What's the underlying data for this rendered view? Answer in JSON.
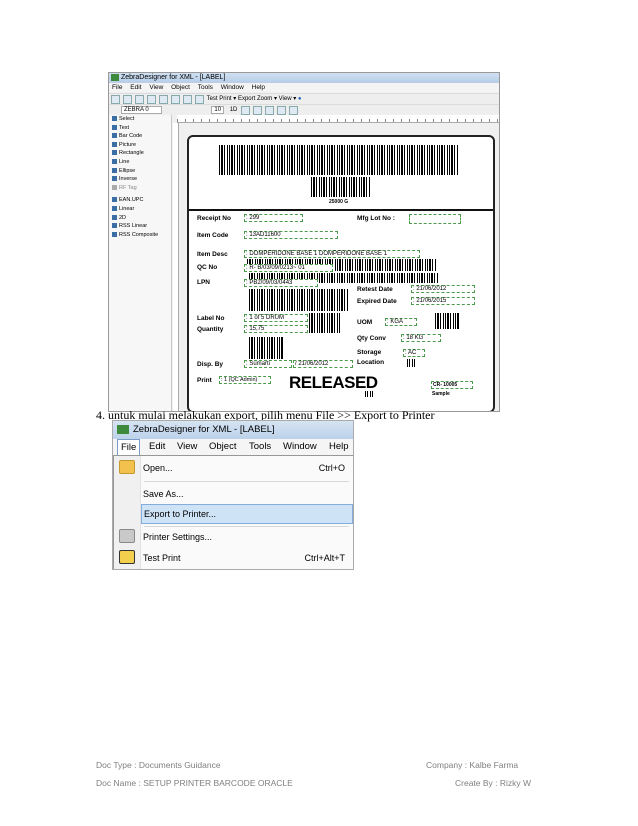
{
  "shot1": {
    "title": "ZebraDesigner for XML - [LABEL]",
    "menu": [
      "File",
      "Edit",
      "View",
      "Object",
      "Tools",
      "Window",
      "Help"
    ],
    "toolbar1": {
      "test_print": "Test Print",
      "export": "Export",
      "zoom": "Zoom",
      "view": "View"
    },
    "toolbar2": {
      "printer": "ZEBRA 0",
      "font_size": "10",
      "mode": "1D"
    },
    "palette": [
      "Select",
      "Text",
      "Bar Code",
      "Picture",
      "Rectangle",
      "Line",
      "Ellipse",
      "Inverse",
      "RF Tag",
      "EAN.UPC",
      "Linear",
      "2D",
      "RSS Linear",
      "RSS Composite"
    ],
    "label": {
      "barcode_caption": "25000 G",
      "receipt_no_label": "Receipt No",
      "receipt_no": ": 299",
      "mfg_lot_label": "Mfg Lot No :",
      "item_code_label": "Item Code",
      "item_code": ": 13AD11600",
      "item_desc_label": "Item Desc",
      "item_desc": ": DOMPERIDONE BASE 1  DOMPERIDONE BASE 1",
      "qc_no_label": "QC No",
      "qc_no": ": R-  B/03/09/0213~ 01",
      "lpn_label": "LPN",
      "lpn": ": PB2/09/03/0443",
      "retest_label": "Retest Date",
      "retest": ": 21/06/2012",
      "expired_label": "Expired Date",
      "expired": ": 21/06/2015",
      "label_no_label": "Label No",
      "label_no": ": 1 of 5 DRUM",
      "quantity_label": "Quantity",
      "quantity": ": 15,75",
      "uom_label": "UOM",
      "uom": ":  KGA",
      "qty_conv_label": "Qty Conv",
      "qty_conv": ": 18 KG",
      "storage_label": "Storage",
      "location_label": "Location",
      "storage": ": AC",
      "disp_by_label": "Disp. By",
      "disp_by": ": Sumarti",
      "disp_date": "/ 21/06/2012",
      "print_label": "Print",
      "print_value": ": 1 (QC Admin)",
      "released": "RELEASED",
      "cr_value": "CR-   10005",
      "sample": "Sample"
    }
  },
  "caption": "4.   untuk mulai melakukan export, pilih menu File >> Export to Printer",
  "shot2": {
    "title": "ZebraDesigner for XML - [LABEL]",
    "menu": [
      "File",
      "Edit",
      "View",
      "Object",
      "Tools",
      "Window",
      "Help"
    ],
    "items": [
      {
        "label": "Open...",
        "shortcut": "Ctrl+O"
      },
      {
        "label": "Save As...",
        "shortcut": ""
      },
      {
        "label": "Export to Printer...",
        "shortcut": ""
      },
      {
        "label": "Printer Settings...",
        "shortcut": ""
      },
      {
        "label": "Test Print",
        "shortcut": "Ctrl+Alt+T"
      }
    ]
  },
  "footer": {
    "doc_type": "Doc Type : Documents Guidance",
    "doc_name": "Doc Name : SETUP PRINTER BARCODE ORACLE",
    "company": "Company : Kalbe Farma",
    "created_by": "Create By : Rizky W"
  },
  "colors": {
    "menu_highlight": "#cfe3f7",
    "dashed_field": "#4c9a4c",
    "footer_text": "#7f7f7f"
  }
}
